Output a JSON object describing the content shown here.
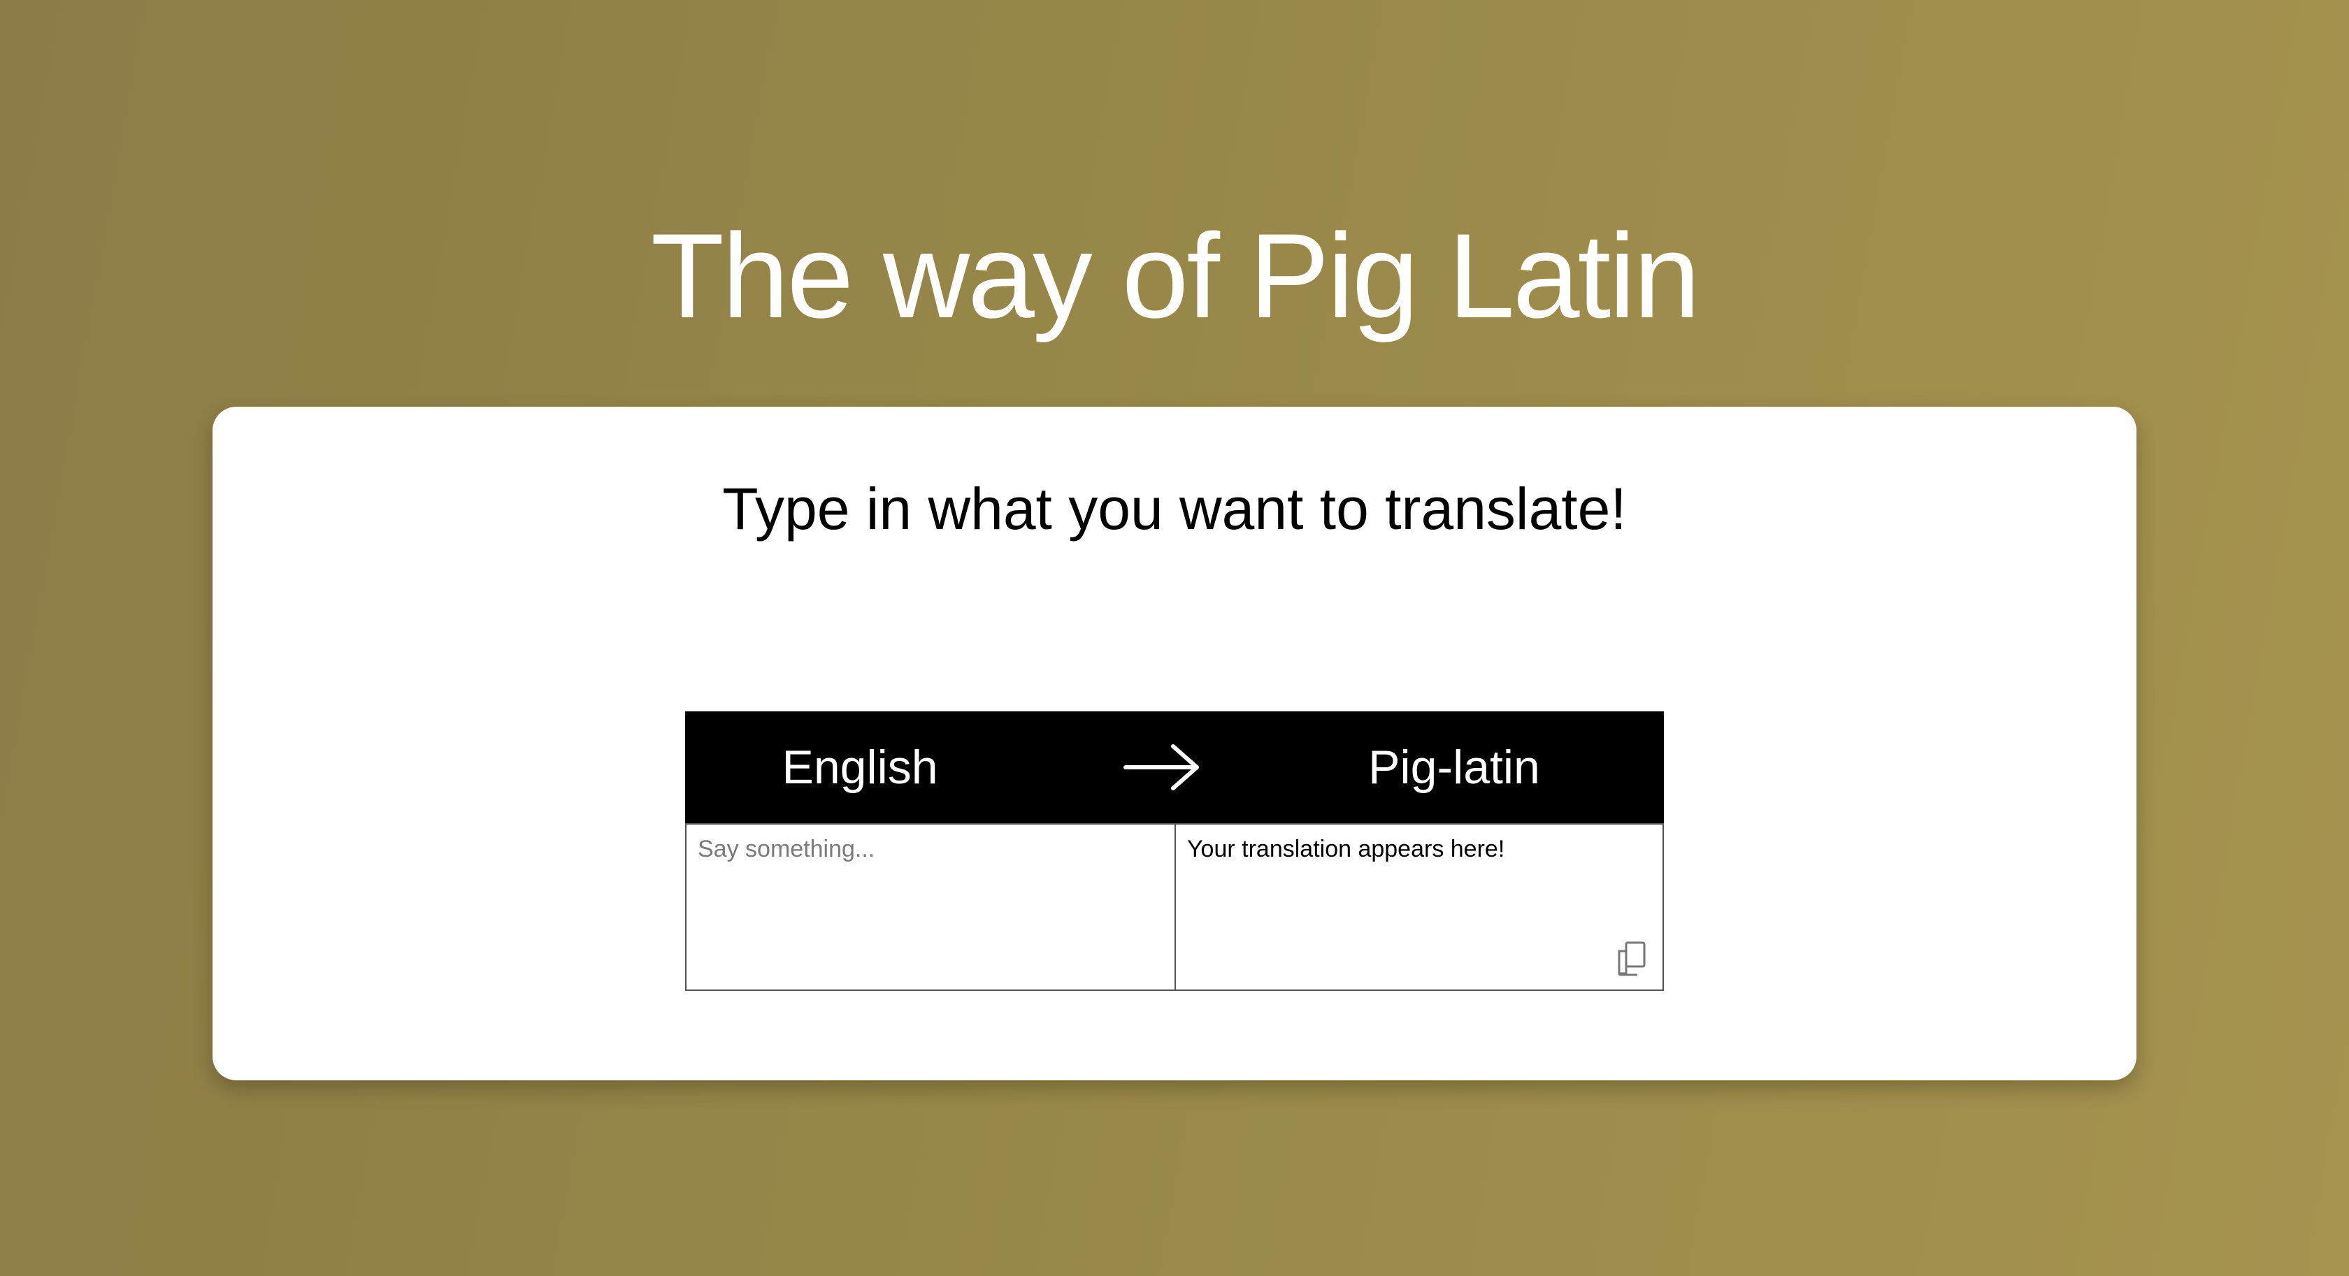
{
  "header": {
    "title": "The way of Pig Latin"
  },
  "card": {
    "subtitle": "Type in what you want to translate!"
  },
  "translator": {
    "source_language": "English",
    "target_language": "Pig-latin",
    "arrow_icon": "arrow-right-icon",
    "input": {
      "value": "",
      "placeholder": "Say something..."
    },
    "output": {
      "text": "Your translation appears here!"
    },
    "copy_icon": "copy-icon"
  },
  "colors": {
    "background_start": "#8c7c48",
    "background_end": "#a69350",
    "card": "#ffffff",
    "lang_bar": "#000000",
    "title_text": "#ffffff"
  }
}
